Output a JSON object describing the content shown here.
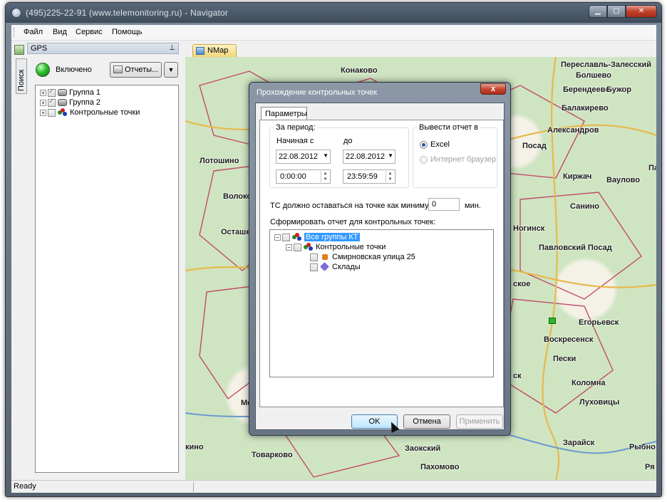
{
  "window": {
    "title": "(495)225-22-91  (www.telemonitoring.ru) - Navigator"
  },
  "menu": [
    "Файл",
    "Вид",
    "Сервис",
    "Помощь"
  ],
  "dock": {
    "search_tab": "Поиск"
  },
  "gps_panel": {
    "title": "GPS",
    "pin": "⊥",
    "status": "Включено",
    "reports_button": "Отчеты...",
    "tree": [
      {
        "label": "Группа 1",
        "checked": true
      },
      {
        "label": "Группа 2",
        "checked": true
      },
      {
        "label": "Контрольные точки",
        "checked": false
      }
    ]
  },
  "map": {
    "tab": "NMap",
    "labels": [
      {
        "text": "Конаково"
      },
      {
        "text": "Переславль-Залесский"
      },
      {
        "text": "Болшево"
      },
      {
        "text": "Берендеево"
      },
      {
        "text": "Бужор"
      },
      {
        "text": "Балакирево"
      },
      {
        "text": "Александров"
      },
      {
        "text": "Посад"
      },
      {
        "text": "Лотошино"
      },
      {
        "text": "Киржач"
      },
      {
        "text": "Ваулово"
      },
      {
        "text": "Па"
      },
      {
        "text": "Волоко"
      },
      {
        "text": "Санино"
      },
      {
        "text": "Осташе"
      },
      {
        "text": "Ногинск"
      },
      {
        "text": "Павловский Посад"
      },
      {
        "text": "ское"
      },
      {
        "text": "Егорьевск"
      },
      {
        "text": "Воскресенск"
      },
      {
        "text": "Пески"
      },
      {
        "text": "ск"
      },
      {
        "text": "Коломна"
      },
      {
        "text": "Луховицы"
      },
      {
        "text": "Ме"
      },
      {
        "text": "Зарайск"
      },
      {
        "text": "Рыбно"
      },
      {
        "text": "кино"
      },
      {
        "text": "Заокский"
      },
      {
        "text": "Товарково"
      },
      {
        "text": "Пахомово"
      },
      {
        "text": "Ря"
      }
    ]
  },
  "status": {
    "text": "Ready"
  },
  "dialog": {
    "title": "Прохождение контрольных точек",
    "close": "x",
    "tab": "Параметры",
    "period": {
      "title": "За период:",
      "from_label": "Начиная с",
      "to_label": "до",
      "from_date": "22.08.2012",
      "to_date": "22.08.2012",
      "from_time": "0:00:00",
      "to_time": "23:59:59"
    },
    "output": {
      "title": "Вывести отчет в",
      "options": [
        {
          "label": "Excel",
          "selected": true,
          "enabled": true
        },
        {
          "label": "Интернет браузер",
          "selected": false,
          "enabled": false
        }
      ]
    },
    "min_stay": {
      "label": "ТС должно оставаться на точке как минимум",
      "value": "0",
      "unit": "мин."
    },
    "tree_caption": "Сформировать отчет для контрольных точек:",
    "tree": [
      {
        "label": "Все группы КТ",
        "level": 0,
        "selected": true
      },
      {
        "label": "Контрольные точки",
        "level": 1
      },
      {
        "label": "Смирновская улица 25",
        "level": 2
      },
      {
        "label": "Склады",
        "level": 2
      }
    ],
    "buttons": {
      "ok": "OK",
      "cancel": "Отмена",
      "apply": "Применить"
    }
  }
}
